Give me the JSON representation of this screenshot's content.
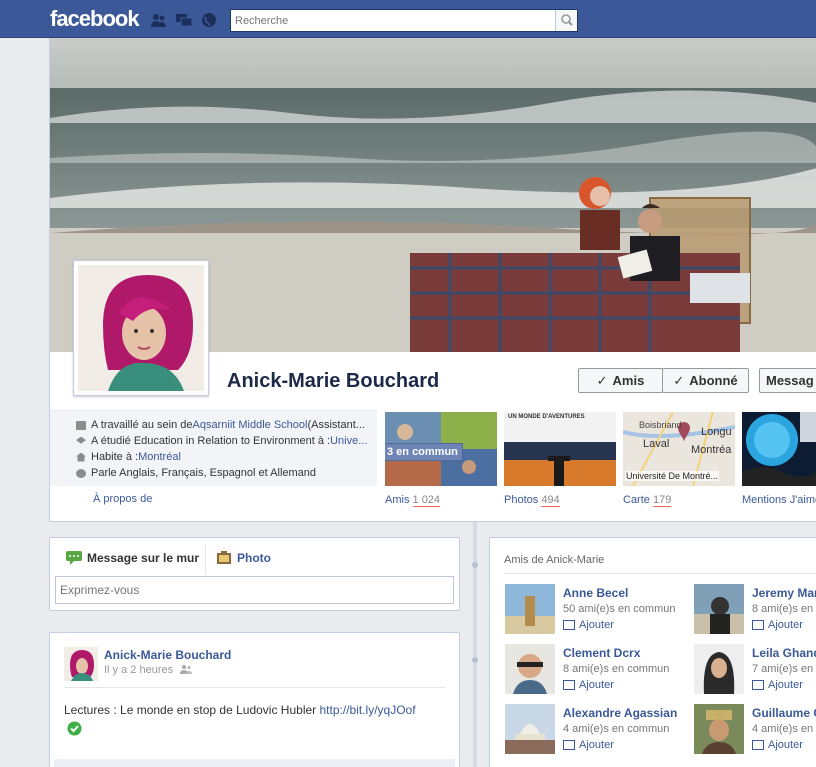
{
  "header": {
    "logo": "facebook",
    "search_placeholder": "Recherche"
  },
  "profile": {
    "name": "Anick-Marie Bouchard",
    "buttons": {
      "friends": "Amis",
      "subscribed": "Abonné",
      "message": "Messag"
    },
    "info": {
      "work_prefix": "A travaillé au sein de ",
      "work_link": "Aqsarniit Middle School",
      "work_suffix": " (Assistant...",
      "study_prefix": "A étudié Education in Relation to Environment à : ",
      "study_link": "Unive...",
      "lives_prefix": "Habite à : ",
      "lives_link": "Montréal",
      "languages": "Parle Anglais, Français, Espagnol et Allemand"
    },
    "about_link": "À propos de"
  },
  "sections": {
    "friends": {
      "label": "Amis",
      "count": "1 024",
      "badge": "3 en commun"
    },
    "photos": {
      "label": "Photos",
      "count": "494",
      "thumb_title": "UN MONDE D'AVENTURES"
    },
    "map": {
      "label": "Carte",
      "count": "179",
      "places": [
        "Boisbriand",
        "Laval",
        "Longu",
        "Montréa",
        "Université De Montré..."
      ]
    },
    "likes": {
      "label": "Mentions J'aime"
    }
  },
  "composer": {
    "tab_status": "Message sur le mur",
    "tab_photo": "Photo",
    "placeholder": "Exprimez-vous"
  },
  "post": {
    "author": "Anick-Marie Bouchard",
    "time": "Il y a 2 heures",
    "text": "Lectures : Le monde en stop de Ludovic Hubler ",
    "link": "http://bit.ly/yqJOof"
  },
  "friends_box": {
    "title": "Amis de Anick-Marie",
    "add_label": "Ajouter",
    "list": [
      {
        "name": "Anne Becel",
        "mutual": "50 ami(e)s en commun"
      },
      {
        "name": "Jeremy Mar",
        "mutual": "8 ami(e)s en"
      },
      {
        "name": "Clement Dcrx",
        "mutual": "8 ami(e)s en commun"
      },
      {
        "name": "Leila Ghand",
        "mutual": "7 ami(e)s en"
      },
      {
        "name": "Alexandre Agassian",
        "mutual": "4 ami(e)s en commun"
      },
      {
        "name": "Guillaume C",
        "mutual": "4 ami(e)s en"
      }
    ]
  },
  "colors": {
    "brand": "#3b5998",
    "background": "#e9ebee"
  }
}
